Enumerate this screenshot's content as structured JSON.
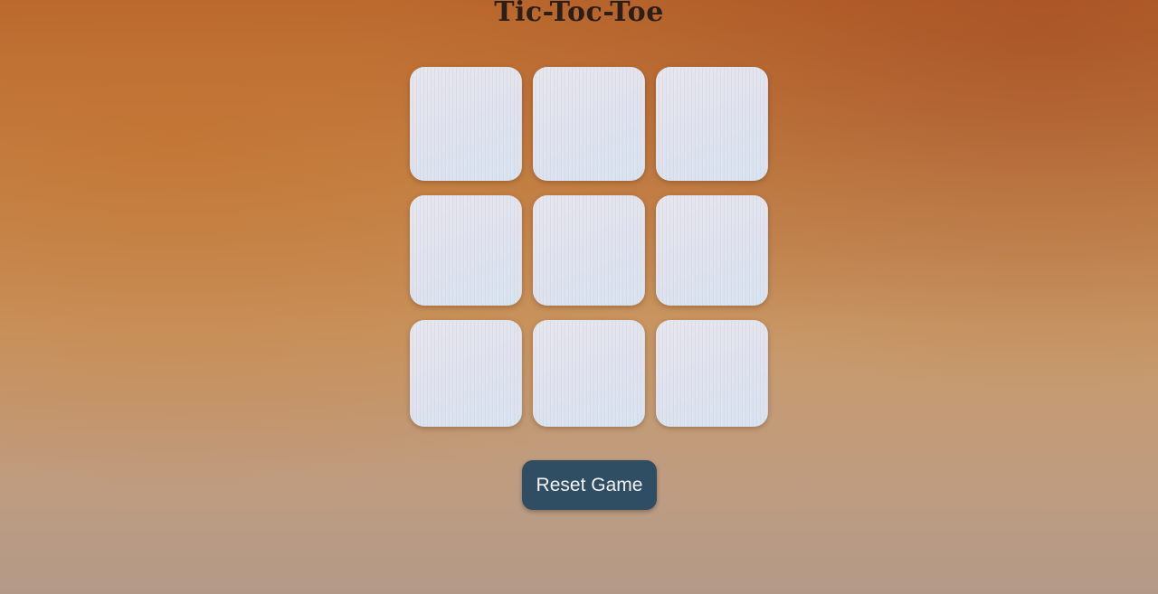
{
  "page": {
    "title": "Tic-Toc-Toe"
  },
  "board": {
    "cells": [
      "",
      "",
      "",
      "",
      "",
      "",
      "",
      "",
      ""
    ]
  },
  "controls": {
    "reset_label": "Reset Game"
  },
  "colors": {
    "button_background": "#2f4d63",
    "button_text": "#f2f2f2",
    "title_text": "#2a1e18",
    "cell_background": "#e2e4ee"
  }
}
